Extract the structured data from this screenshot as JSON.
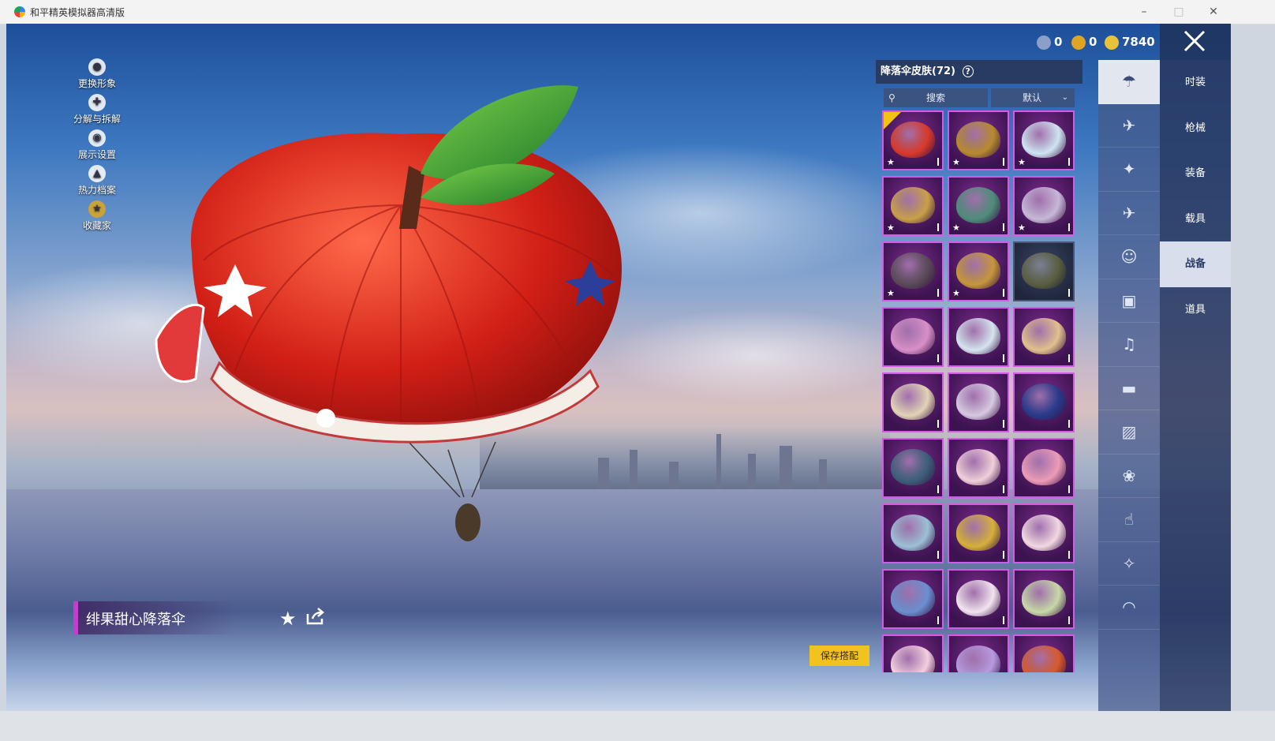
{
  "window": {
    "title": "和平精英模拟器高清版",
    "controls": [
      "minimize",
      "maximize",
      "close"
    ]
  },
  "left_menu": [
    {
      "label": "更换形象",
      "icon": "person-icon"
    },
    {
      "label": "分解与拆解",
      "icon": "dismantle-icon"
    },
    {
      "label": "展示设置",
      "icon": "eye-icon"
    },
    {
      "label": "热力档案",
      "icon": "flame-icon"
    },
    {
      "label": "收藏家",
      "icon": "collector-badge-icon"
    }
  ],
  "currencies": [
    {
      "icon": "globe-coin-icon",
      "value": "0",
      "color": "#8aa0c8"
    },
    {
      "icon": "gold-medal-icon",
      "value": "0",
      "color": "#e0a425"
    },
    {
      "icon": "diamond-coin-icon",
      "value": "7840",
      "color": "#e8c23a"
    }
  ],
  "panel": {
    "title": "降落伞皮肤(72)",
    "help_icon": "help-icon",
    "search_placeholder": "搜索",
    "sort_value": "默认"
  },
  "selected_item": {
    "name": "绯果甜心降落伞"
  },
  "save_button": "保存搭配",
  "grid_items": [
    {
      "tone": "#d83a2a",
      "starred": true,
      "equipped": true
    },
    {
      "tone": "#b88a2e",
      "starred": true,
      "equipped": false
    },
    {
      "tone": "#cfe4f2",
      "starred": true,
      "equipped": false
    },
    {
      "tone": "#c9a048",
      "starred": true,
      "equipped": false
    },
    {
      "tone": "#4f8d7a",
      "starred": true,
      "equipped": false
    },
    {
      "tone": "#c7b8d8",
      "starred": true,
      "equipped": false
    },
    {
      "tone": "#5a4a58",
      "starred": true,
      "equipped": false
    },
    {
      "tone": "#c6963b",
      "starred": true,
      "equipped": false
    },
    {
      "tone": "#5a5e40",
      "starred": false,
      "equipped": false,
      "grey": true
    },
    {
      "tone": "#d98fc9",
      "starred": false,
      "equipped": false
    },
    {
      "tone": "#d6e4ef",
      "starred": false,
      "equipped": false
    },
    {
      "tone": "#e2c08e",
      "starred": false,
      "equipped": false
    },
    {
      "tone": "#e3d3b6",
      "starred": false,
      "equipped": false
    },
    {
      "tone": "#d7c9e1",
      "starred": false,
      "equipped": false
    },
    {
      "tone": "#283a8a",
      "starred": false,
      "equipped": false
    },
    {
      "tone": "#3c5f7a",
      "starred": false,
      "equipped": false
    },
    {
      "tone": "#f1cfd9",
      "starred": false,
      "equipped": false
    },
    {
      "tone": "#ec9cb8",
      "starred": false,
      "equipped": false
    },
    {
      "tone": "#9cc0d6",
      "starred": false,
      "equipped": false
    },
    {
      "tone": "#d6b03a",
      "starred": false,
      "equipped": false
    },
    {
      "tone": "#f2d8e2",
      "starred": false,
      "equipped": false
    },
    {
      "tone": "#6b8fd0",
      "starred": false,
      "equipped": false
    },
    {
      "tone": "#f2e4ef",
      "starred": false,
      "equipped": false
    },
    {
      "tone": "#c8d8a8",
      "starred": false,
      "equipped": false
    },
    {
      "tone": "#f4cfe0",
      "starred": false,
      "equipped": false
    },
    {
      "tone": "#b79ae0",
      "starred": false,
      "equipped": false
    },
    {
      "tone": "#d85a2c",
      "starred": false,
      "equipped": false
    }
  ],
  "icon_bar": [
    {
      "icon": "parachute-icon",
      "active": true
    },
    {
      "icon": "glider-icon"
    },
    {
      "icon": "drone-icon"
    },
    {
      "icon": "plane-icon"
    },
    {
      "icon": "emote-icon"
    },
    {
      "icon": "robot-icon"
    },
    {
      "icon": "sound-icon"
    },
    {
      "icon": "chat-bubble-icon"
    },
    {
      "icon": "picture-icon"
    },
    {
      "icon": "spray-icon"
    },
    {
      "icon": "tap-icon"
    },
    {
      "icon": "sparkle-icon"
    },
    {
      "icon": "hat-icon"
    }
  ],
  "tabs": [
    {
      "label": "时装"
    },
    {
      "label": "枪械"
    },
    {
      "label": "装备"
    },
    {
      "label": "载具"
    },
    {
      "label": "战备",
      "active": true
    },
    {
      "label": "道具"
    }
  ]
}
